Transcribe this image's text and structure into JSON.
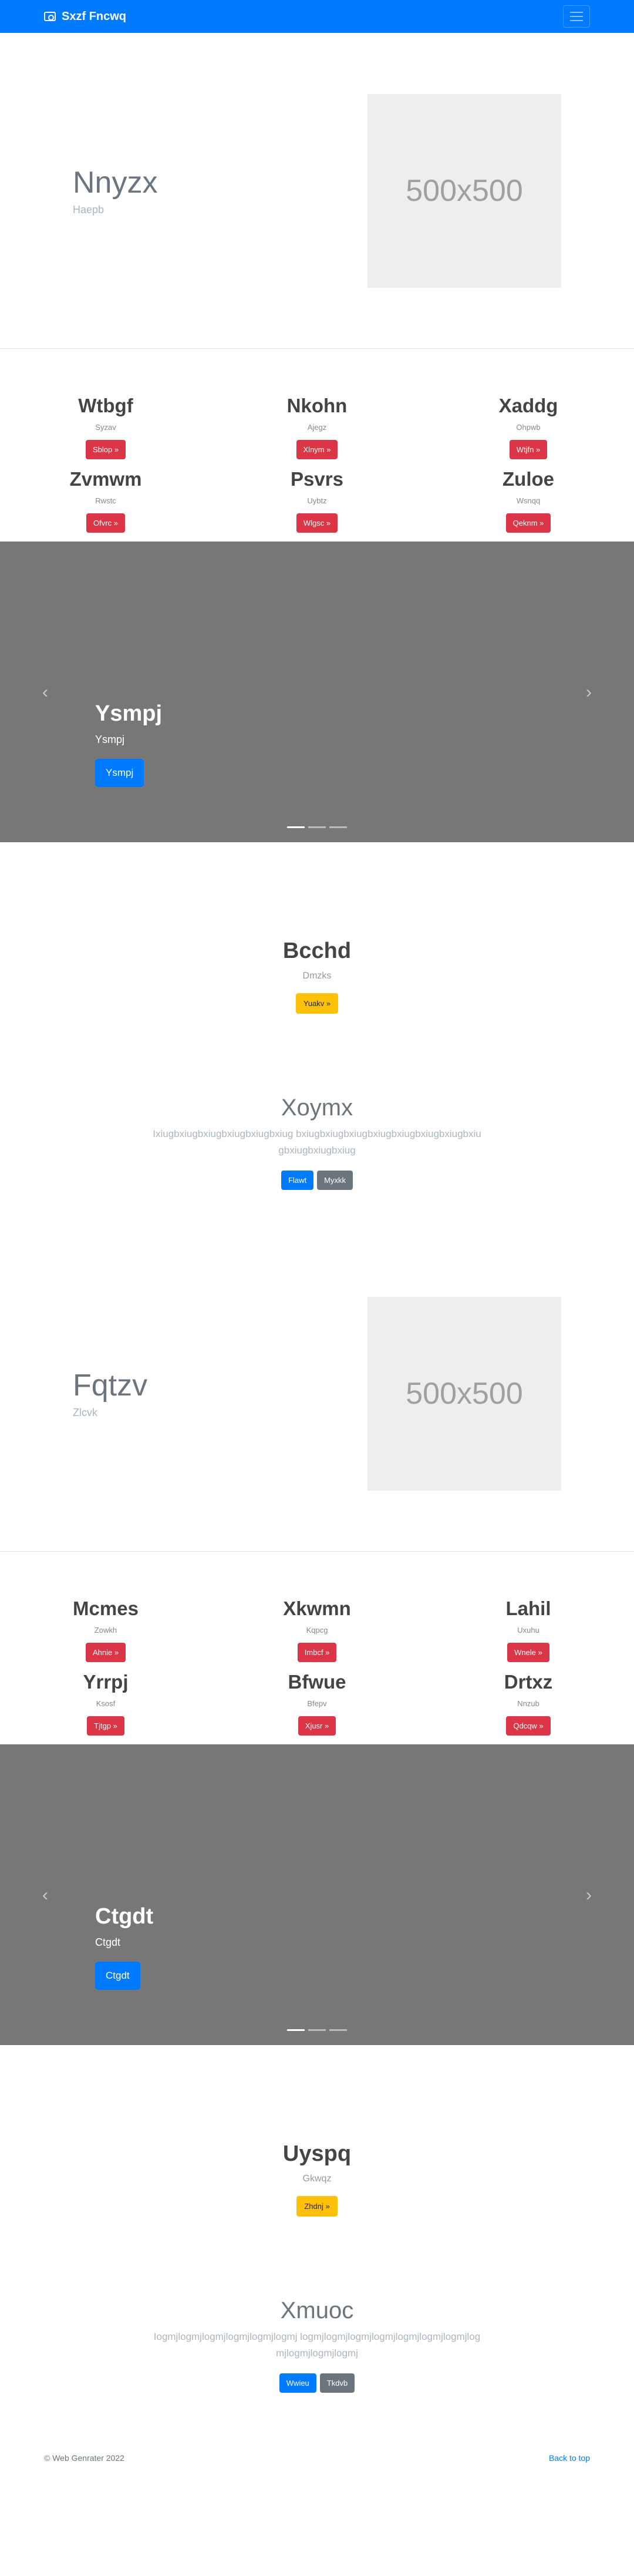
{
  "navbar": {
    "brand": "Sxzf Fncwq",
    "brand_icon": "camera-icon",
    "toggler_icon": "hamburger-icon",
    "bg_color": "#007bff"
  },
  "hero1": {
    "title": "Nnyzx",
    "subtitle": "Haepb",
    "placeholder": "500x500"
  },
  "features1": [
    {
      "title": "Wtbgf",
      "subtitle": "Syzav",
      "button": "Sblop »"
    },
    {
      "title": "Nkohn",
      "subtitle": "Ajegz",
      "button": "Xlnym »"
    },
    {
      "title": "Xaddg",
      "subtitle": "Ohpwb",
      "button": "Wtjfn »"
    },
    {
      "title": "Zvmwm",
      "subtitle": "Rwstc",
      "button": "Ofvrc »"
    },
    {
      "title": "Psvrs",
      "subtitle": "Uybtz",
      "button": "Wlgsc »"
    },
    {
      "title": "Zuloe",
      "subtitle": "Wsnqq",
      "button": "Qeknm »"
    }
  ],
  "carousel1": {
    "title": "Ysmpj",
    "subtitle": "Ysmpj",
    "button": "Ysmpj"
  },
  "center1": {
    "title": "Bcchd",
    "subtitle": "Dmzks",
    "button": "Yuakv »"
  },
  "jumbo1": {
    "title": "Xoymx",
    "lead": "Ixiugbxiugbxiugbxiugbxiugbxiug bxiugbxiugbxiugbxiugbxiugbxiugbxiugbxiugbxiugbxiugbxiug",
    "btn_primary": "Flawt",
    "btn_secondary": "Myxkk"
  },
  "hero2": {
    "title": "Fqtzv",
    "subtitle": "Zlcvk",
    "placeholder": "500x500"
  },
  "features2": [
    {
      "title": "Mcmes",
      "subtitle": "Zowkh",
      "button": "Ahnie »"
    },
    {
      "title": "Xkwmn",
      "subtitle": "Kqpcg",
      "button": "Imbcf »"
    },
    {
      "title": "Lahil",
      "subtitle": "Uxuhu",
      "button": "Wnele »"
    },
    {
      "title": "Yrrpj",
      "subtitle": "Ksosf",
      "button": "Tjtgp »"
    },
    {
      "title": "Bfwue",
      "subtitle": "Bfepv",
      "button": "Xjusr »"
    },
    {
      "title": "Drtxz",
      "subtitle": "Nnzub",
      "button": "Qdcqw »"
    }
  ],
  "carousel2": {
    "title": "Ctgdt",
    "subtitle": "Ctgdt",
    "button": "Ctgdt"
  },
  "center2": {
    "title": "Uyspq",
    "subtitle": "Gkwqz",
    "button": "Zhdnj »"
  },
  "jumbo2": {
    "title": "Xmuoc",
    "lead": "Iogmjlogmjlogmjlogmjlogmjlogmj logmjlogmjlogmjlogmjlogmjlogmjlogmjlogmjlogmjlogmjlogmj",
    "btn_primary": "Wwieu",
    "btn_secondary": "Tkdvb"
  },
  "footer": {
    "copyright": "© Web Genrater 2022",
    "back_to_top": "Back to top"
  },
  "carousel_controls": {
    "prev_icon": "chevron-left-icon",
    "next_icon": "chevron-right-icon"
  }
}
